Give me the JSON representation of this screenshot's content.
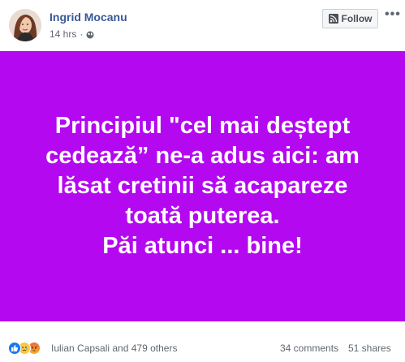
{
  "post": {
    "author": "Ingrid Mocanu",
    "time": "14 hrs",
    "separator": "·",
    "privacy_icon": "globe-icon",
    "follow_label": "Follow",
    "more_label": "•••",
    "background_color": "#b408f0",
    "text": "Principiul \"cel mai deștept\ncedează” ne-a adus aici: am\nlăsat cretinii să acapareze\ntoată puterea.\nPăi atunci ... bine!"
  },
  "footer": {
    "reaction_icons": [
      "like-icon",
      "sad-icon",
      "angry-icon"
    ],
    "reactors": "Iulian Capsali and 479 others",
    "comments": "34 comments",
    "shares": "51 shares"
  },
  "colors": {
    "author_link": "#385898",
    "meta_text": "#616770",
    "like_blue": "#1877f2"
  }
}
